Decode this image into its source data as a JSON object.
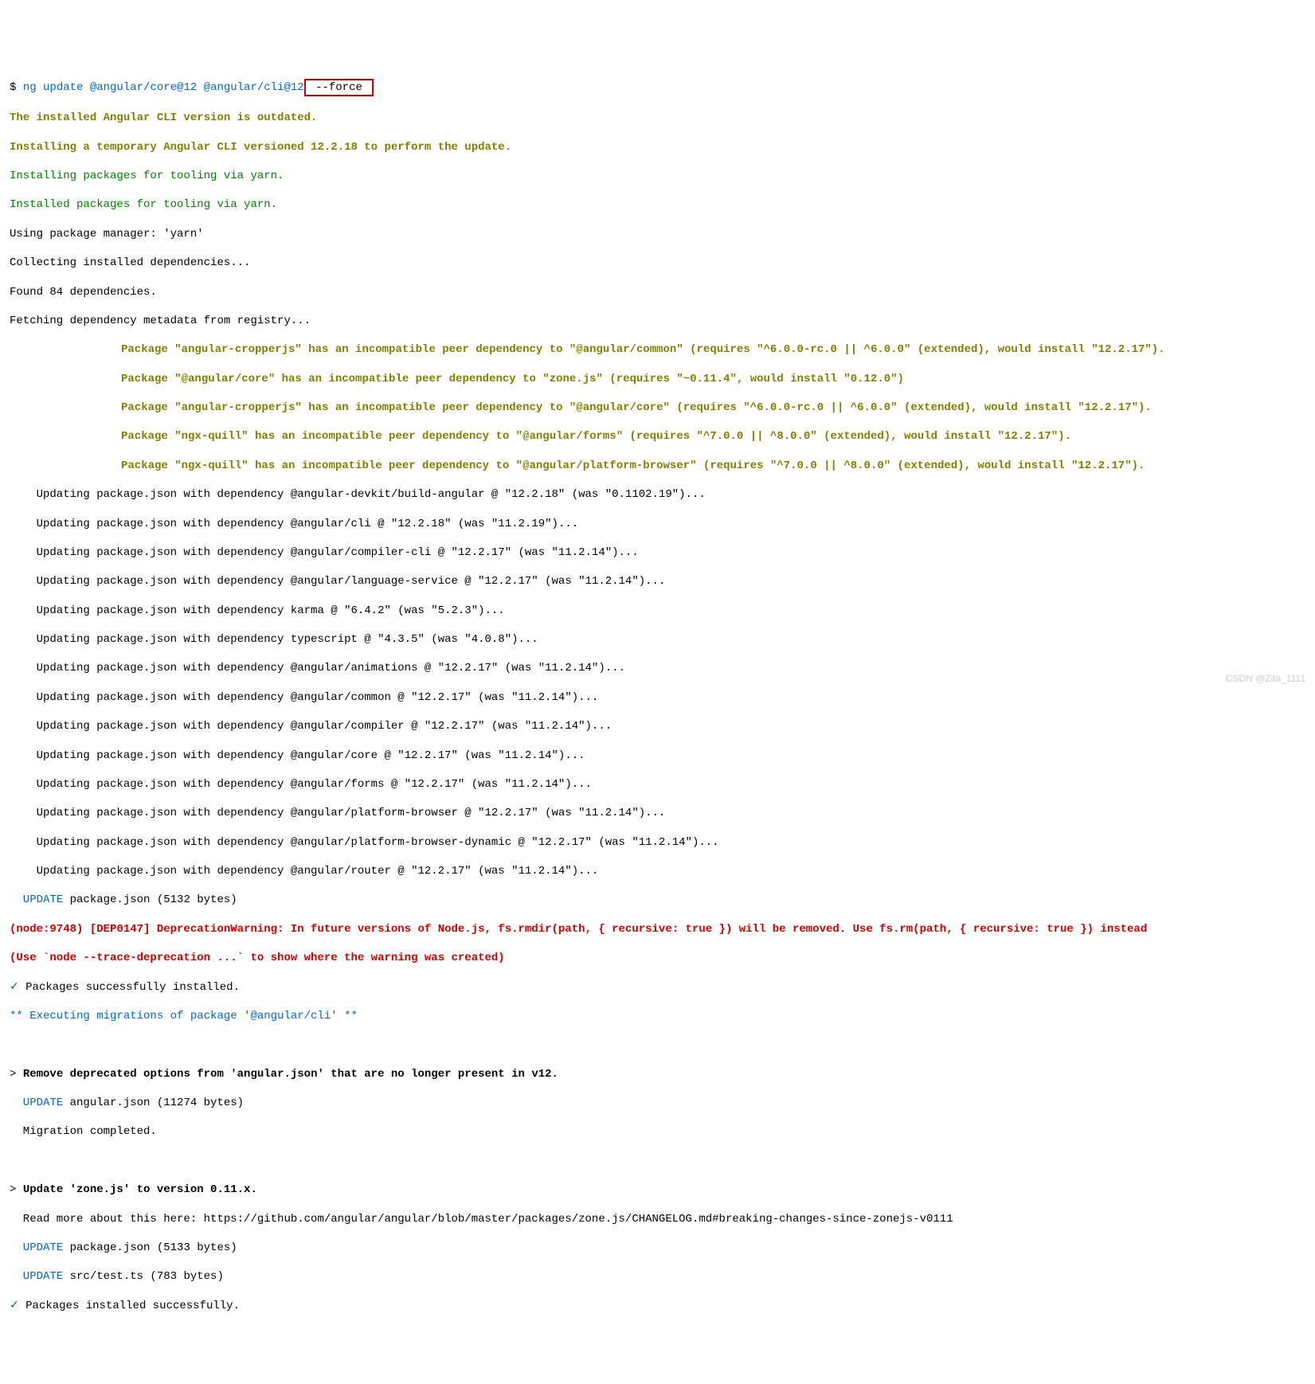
{
  "cmd": {
    "prompt": "$ ",
    "command": "ng update @angular/core@12 @angular/cli@12",
    "force_flag": " --force "
  },
  "lines": {
    "l1": "The installed Angular CLI version is outdated.",
    "l2": "Installing a temporary Angular CLI versioned 12.2.18 to perform the update.",
    "l3": "Installing packages for tooling via yarn.",
    "l4": "Installed packages for tooling via yarn.",
    "l5": "Using package manager: 'yarn'",
    "l6": "Collecting installed dependencies...",
    "l7": "Found 84 dependencies.",
    "l8": "Fetching dependency metadata from registry...",
    "w1": "Package \"angular-cropperjs\" has an incompatible peer dependency to \"@angular/common\" (requires \"^6.0.0-rc.0 || ^6.0.0\" (extended), would install \"12.2.17\").",
    "w2": "Package \"@angular/core\" has an incompatible peer dependency to \"zone.js\" (requires \"~0.11.4\", would install \"0.12.0\")",
    "w3": "Package \"angular-cropperjs\" has an incompatible peer dependency to \"@angular/core\" (requires \"^6.0.0-rc.0 || ^6.0.0\" (extended), would install \"12.2.17\").",
    "w4": "Package \"ngx-quill\" has an incompatible peer dependency to \"@angular/forms\" (requires \"^7.0.0 || ^8.0.0\" (extended), would install \"12.2.17\").",
    "w5": "Package \"ngx-quill\" has an incompatible peer dependency to \"@angular/platform-browser\" (requires \"^7.0.0 || ^8.0.0\" (extended), would install \"12.2.17\").",
    "u1": "    Updating package.json with dependency @angular-devkit/build-angular @ \"12.2.18\" (was \"0.1102.19\")...",
    "u2": "    Updating package.json with dependency @angular/cli @ \"12.2.18\" (was \"11.2.19\")...",
    "u3": "    Updating package.json with dependency @angular/compiler-cli @ \"12.2.17\" (was \"11.2.14\")...",
    "u4": "    Updating package.json with dependency @angular/language-service @ \"12.2.17\" (was \"11.2.14\")...",
    "u5": "    Updating package.json with dependency karma @ \"6.4.2\" (was \"5.2.3\")...",
    "u6": "    Updating package.json with dependency typescript @ \"4.3.5\" (was \"4.0.8\")...",
    "u7": "    Updating package.json with dependency @angular/animations @ \"12.2.17\" (was \"11.2.14\")...",
    "u8": "    Updating package.json with dependency @angular/common @ \"12.2.17\" (was \"11.2.14\")...",
    "u9": "    Updating package.json with dependency @angular/compiler @ \"12.2.17\" (was \"11.2.14\")...",
    "u10": "    Updating package.json with dependency @angular/core @ \"12.2.17\" (was \"11.2.14\")...",
    "u11": "    Updating package.json with dependency @angular/forms @ \"12.2.17\" (was \"11.2.14\")...",
    "u12": "    Updating package.json with dependency @angular/platform-browser @ \"12.2.17\" (was \"11.2.14\")...",
    "u13": "    Updating package.json with dependency @angular/platform-browser-dynamic @ \"12.2.17\" (was \"11.2.14\")...",
    "u14": "    Updating package.json with dependency @angular/router @ \"12.2.17\" (was \"11.2.14\")...",
    "update1": "  UPDATE",
    "update1_rest": " package.json (5132 bytes)",
    "dep1": "(node:9748) [DEP0147] DeprecationWarning: In future versions of Node.js, fs.rmdir(path, { recursive: true }) will be removed. Use fs.rm(path, { recursive: true }) instead",
    "dep2": "(Use `node --trace-deprecation ...` to show where the warning was created)",
    "check1": "✓",
    "check1_rest": " Packages successfully installed.",
    "exec": "** Executing migrations of package '@angular/cli' **",
    "m1_prefix": "> ",
    "m1": "Remove deprecated options from 'angular.json' that are no longer present in v12.",
    "m1_update": "  UPDATE",
    "m1_update_rest": " angular.json (11274 bytes)",
    "m1_done": "  Migration completed.",
    "m2_prefix": "> ",
    "m2": "Update 'zone.js' to version 0.11.x.",
    "m2_read": "  Read more about this here: https://github.com/angular/angular/blob/master/packages/zone.js/CHANGELOG.md#breaking-changes-since-zonejs-v0111",
    "m2_u1": "  UPDATE",
    "m2_u1_rest": " package.json (5133 bytes)",
    "m2_u2": "  UPDATE",
    "m2_u2_rest": " src/test.ts (783 bytes)",
    "check2": "✓",
    "check2_rest": " Packages installed successfully."
  },
  "watermark": "CSDN @Zita_1111"
}
